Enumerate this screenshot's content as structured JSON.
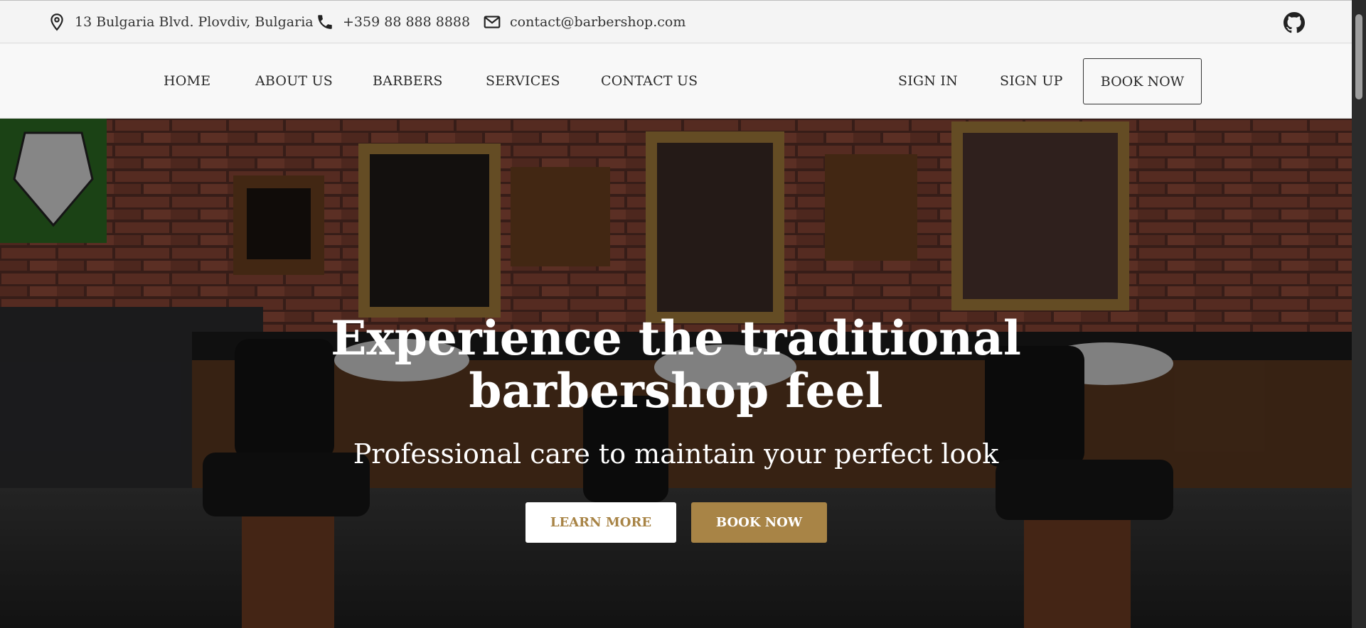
{
  "topbar": {
    "address": "13 Bulgaria Blvd. Plovdiv, Bulgaria",
    "phone": "+359 88 888 8888",
    "email": "contact@barbershop.com",
    "icons": [
      "location-pin-icon",
      "phone-icon",
      "mail-icon",
      "github-icon"
    ]
  },
  "nav": {
    "links": [
      "HOME",
      "ABOUT US",
      "BARBERS",
      "SERVICES",
      "CONTACT US"
    ],
    "sign_in": "SIGN IN",
    "sign_up": "SIGN UP",
    "book_now": "BOOK NOW"
  },
  "hero": {
    "title_line1": "Experience the traditional",
    "title_line2": "barbershop feel",
    "subtitle": "Professional care to maintain your perfect look",
    "learn_more": "LEARN MORE",
    "book_now": "BOOK NOW"
  },
  "colors": {
    "accent": "#a88446",
    "text_dark": "#2b2b2b",
    "bar_bg": "#f4f4f4",
    "brick": "#7a3f32"
  }
}
